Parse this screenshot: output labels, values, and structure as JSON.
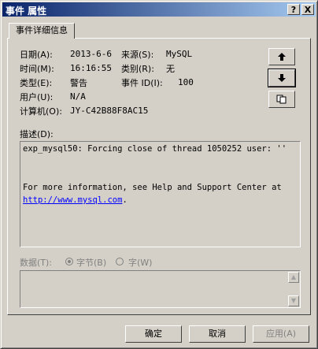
{
  "window": {
    "title": "事件 属性",
    "help_glyph": "?",
    "close_glyph": "X"
  },
  "tab": {
    "label": "事件详细信息"
  },
  "fields": {
    "date_label": "日期(A):",
    "date_value": "2013-6-6",
    "source_label": "来源(S):",
    "source_value": "MySQL",
    "time_label": "时间(M):",
    "time_value": "16:16:55",
    "category_label": "类别(R):",
    "category_value": "无",
    "type_label": "类型(E):",
    "type_value": "警告",
    "event_id_label": "事件 ID(I):",
    "event_id_value": "100",
    "user_label": "用户(U):",
    "user_value": "N/A",
    "computer_label": "计算机(O):",
    "computer_value": "JY-C42B88F8AC15"
  },
  "nav": {
    "up_glyph": "🡅",
    "down_glyph": "🡇",
    "copy_glyph": "⎘"
  },
  "description": {
    "label": "描述(D):",
    "line1": "exp_mysql50: Forcing close of thread 1050252  user: ''",
    "line2": "For more information, see Help and Support Center at",
    "link": "http://www.mysql.com",
    "link_suffix": "."
  },
  "data": {
    "label": "数据(T):",
    "bytes_label": "字节(B)",
    "words_label": "字(W)"
  },
  "buttons": {
    "ok": "确定",
    "cancel": "取消",
    "apply": "应用(A)"
  }
}
